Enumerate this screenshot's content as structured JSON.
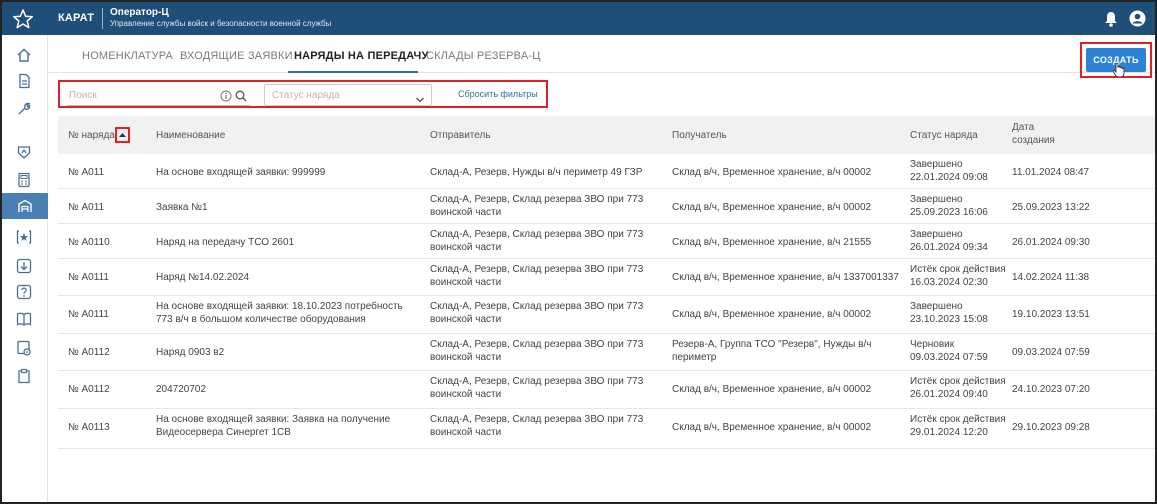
{
  "topbar": {
    "brand": "КАРАТ",
    "operator": "Оператор-Ц",
    "subtitle": "Управление службы войск и безопасности военной службы",
    "icons": [
      "star-icon",
      "bell-icon",
      "user-icon"
    ]
  },
  "sidebar": {
    "icons": [
      "home-icon",
      "document-icon",
      "wrench-icon",
      "shield-icon",
      "calculator-icon",
      "warehouse-icon",
      "star-box-icon",
      "download-box-icon",
      "help-box-icon",
      "book-icon",
      "settings-doc-icon",
      "clipboard-icon"
    ],
    "active_index": 5
  },
  "tabs": [
    "НОМЕНКЛАТУРА",
    "ВХОДЯЩИЕ ЗАЯВКИ",
    "НАРЯДЫ НА ПЕРЕДАЧУ",
    "СКЛАДЫ РЕЗЕРВА-Ц"
  ],
  "active_tab": "НАРЯДЫ НА ПЕРЕДАЧУ",
  "create_label": "СОЗДАТЬ",
  "filters": {
    "search_placeholder": "Поиск",
    "status_placeholder": "Статус наряда",
    "reset_label": "Сбросить фильтры"
  },
  "table": {
    "headers": {
      "number": "№ наряда",
      "name": "Наименование",
      "sender": "Отправитель",
      "receiver": "Получатель",
      "status": "Статус наряда",
      "date_1": "Дата",
      "date_2": "создания"
    },
    "rows": [
      {
        "number": "№ А011",
        "name": [
          "На основе входящей заявки: 999999"
        ],
        "sender": [
          "Склад-А, Резерв, Нужды в/ч периметр 49 ГЗР"
        ],
        "receiver": [
          "Склад в/ч, Временное хранение, в/ч 00002"
        ],
        "status": "Завершено",
        "status_date": "22.01.2024 09:08",
        "created": "11.01.2024 08:47"
      },
      {
        "number": "№ А011",
        "name": [
          "Заявка №1"
        ],
        "sender": [
          "Склад-А, Резерв, Склад резерва ЗВО при 773",
          "воинской части"
        ],
        "receiver": [
          "Склад в/ч, Временное хранение, в/ч 00002"
        ],
        "status": "Завершено",
        "status_date": "25.09.2023 16:06",
        "created": "25.09.2023 13:22"
      },
      {
        "number": "№ А0110",
        "name": [
          "Наряд на передачу ТСО 2601"
        ],
        "sender": [
          "Склад-А, Резерв, Склад резерва ЗВО при 773",
          "воинской части"
        ],
        "receiver": [
          "Склад в/ч, Временное хранение, в/ч 21555"
        ],
        "status": "Завершено",
        "status_date": "26.01.2024 09:34",
        "created": "26.01.2024 09:30"
      },
      {
        "number": "№ А0111",
        "name": [
          "Наряд №14.02.2024"
        ],
        "sender": [
          "Склад-А, Резерв, Склад резерва ЗВО при 773",
          "воинской части"
        ],
        "receiver": [
          "Склад в/ч, Временное хранение, в/ч 1337001337"
        ],
        "status": "Истёк срок действия",
        "status_date": "16.03.2024 02:30",
        "created": "14.02.2024 11:38"
      },
      {
        "number": "№ А0111",
        "name": [
          "На основе входящей заявки: 18.10.2023 потребность",
          "773 в/ч в большом количестве оборудования"
        ],
        "sender": [
          "Склад-А, Резерв, Склад резерва ЗВО при 773",
          "воинской части"
        ],
        "receiver": [
          "Склад в/ч, Временное хранение, в/ч 00002"
        ],
        "status": "Завершено",
        "status_date": "23.10.2023 15:08",
        "created": "19.10.2023 13:51"
      },
      {
        "number": "№ А0112",
        "name": [
          "Наряд 0903 в2"
        ],
        "sender": [
          "Склад-А, Резерв, Склад резерва ЗВО при 773",
          "воинской части"
        ],
        "receiver": [
          "Резерв-А, Группа ТСО \"Резерв\", Нужды в/ч",
          "периметр"
        ],
        "status": "Черновик",
        "status_date": "09.03.2024 07:59",
        "created": "09.03.2024 07:59"
      },
      {
        "number": "№ А0112",
        "name": [
          "204720702"
        ],
        "sender": [
          "Склад-А, Резерв, Склад резерва ЗВО при 773",
          "воинской части"
        ],
        "receiver": [
          "Склад в/ч, Временное хранение, в/ч 00002"
        ],
        "status": "Истёк срок действия",
        "status_date": "26.01.2024 09:40",
        "created": "24.10.2023 07:20"
      },
      {
        "number": "№ А0113",
        "name": [
          "На основе входящей заявки: Заявка на получение",
          "Видеосервера Синергет 1СВ"
        ],
        "sender": [
          "Склад-А, Резерв, Склад резерва ЗВО при 773",
          "воинской части"
        ],
        "receiver": [
          "Склад в/ч, Временное хранение, в/ч 00002"
        ],
        "status": "Истёк срок действия",
        "status_date": "29.01.2024 12:20",
        "created": "29.10.2023 09:28"
      }
    ]
  }
}
